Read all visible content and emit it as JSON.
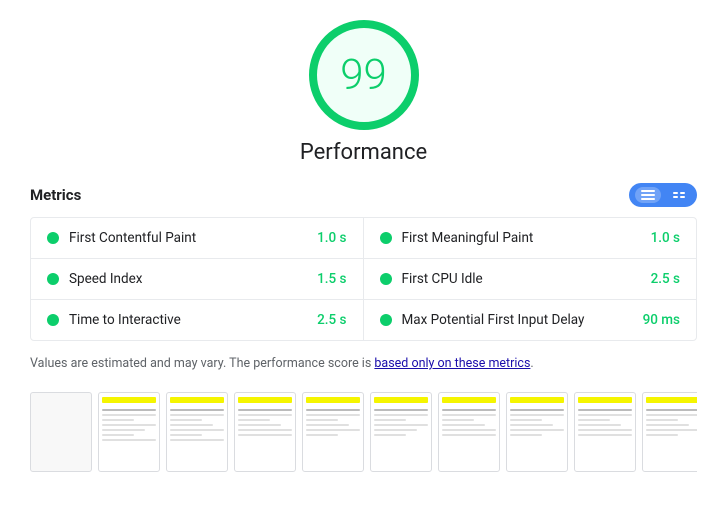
{
  "score": {
    "value": "99",
    "label": "Performance"
  },
  "metrics_header": {
    "title": "Metrics"
  },
  "toggle": {
    "list_label": "List view",
    "grid_label": "Grid view"
  },
  "metrics": [
    {
      "name": "First Contentful Paint",
      "value": "1.0 s",
      "color": "#0cce6b"
    },
    {
      "name": "First Meaningful Paint",
      "value": "1.0 s",
      "color": "#0cce6b"
    },
    {
      "name": "Speed Index",
      "value": "1.5 s",
      "color": "#0cce6b"
    },
    {
      "name": "First CPU Idle",
      "value": "2.5 s",
      "color": "#0cce6b"
    },
    {
      "name": "Time to Interactive",
      "value": "2.5 s",
      "color": "#0cce6b"
    },
    {
      "name": "Max Potential First Input Delay",
      "value": "90 ms",
      "color": "#0cce6b"
    }
  ],
  "note": {
    "text_before": "Values are estimated and may vary. The performance score is ",
    "link_text": "based only on these metrics",
    "text_after": "."
  },
  "filmstrip": {
    "frames": [
      0,
      1,
      2,
      3,
      4,
      5,
      6,
      7,
      8,
      9
    ]
  }
}
